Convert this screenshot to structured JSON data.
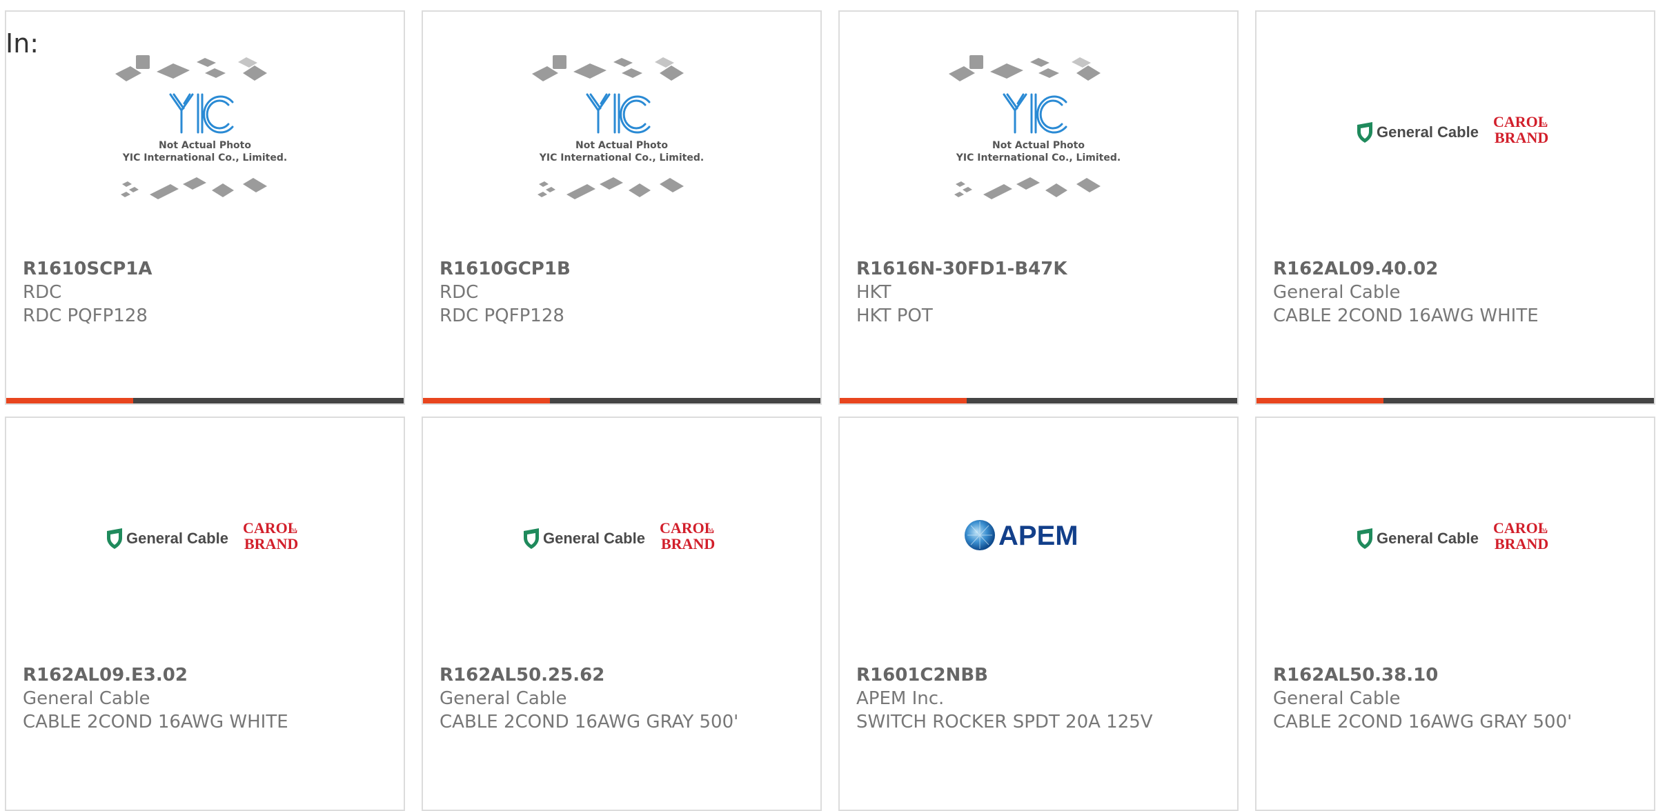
{
  "page": {
    "label": "In:"
  },
  "colors": {
    "accent": "#e8451e",
    "bar": "#444444",
    "yic_blue": "#2a8ad4",
    "gc_green": "#1f8a5c",
    "carol_red": "#d21f2b",
    "apem_blue": "#123f8a"
  },
  "logos": {
    "yic": {
      "brand": "YIC",
      "line1": "Not Actual Photo",
      "line2": "YIC International Co., Limited."
    },
    "general_cable": {
      "name": "General Cable",
      "carol": "CAROL",
      "brand": "BRAND",
      "tm": "TM"
    },
    "apem": {
      "name": "APEM"
    }
  },
  "products": [
    {
      "logo": "yic",
      "part_number": "R1610SCP1A",
      "manufacturer": "RDC",
      "description": "RDC PQFP128"
    },
    {
      "logo": "yic",
      "part_number": "R1610GCP1B",
      "manufacturer": "RDC",
      "description": "RDC PQFP128"
    },
    {
      "logo": "yic",
      "part_number": "R1616N-30FD1-B47K",
      "manufacturer": "HKT",
      "description": "HKT POT"
    },
    {
      "logo": "general_cable",
      "part_number": "R162AL09.40.02",
      "manufacturer": "General Cable",
      "description": "CABLE 2COND 16AWG WHITE"
    },
    {
      "logo": "general_cable",
      "part_number": "R162AL09.E3.02",
      "manufacturer": "General Cable",
      "description": "CABLE 2COND 16AWG WHITE"
    },
    {
      "logo": "general_cable",
      "part_number": "R162AL50.25.62",
      "manufacturer": "General Cable",
      "description": "CABLE 2COND 16AWG GRAY 500'"
    },
    {
      "logo": "apem",
      "part_number": "R1601C2NBB",
      "manufacturer": "APEM Inc.",
      "description": "SWITCH ROCKER SPDT 20A 125V"
    },
    {
      "logo": "general_cable",
      "part_number": "R162AL50.38.10",
      "manufacturer": "General Cable",
      "description": "CABLE 2COND 16AWG GRAY 500'"
    }
  ]
}
